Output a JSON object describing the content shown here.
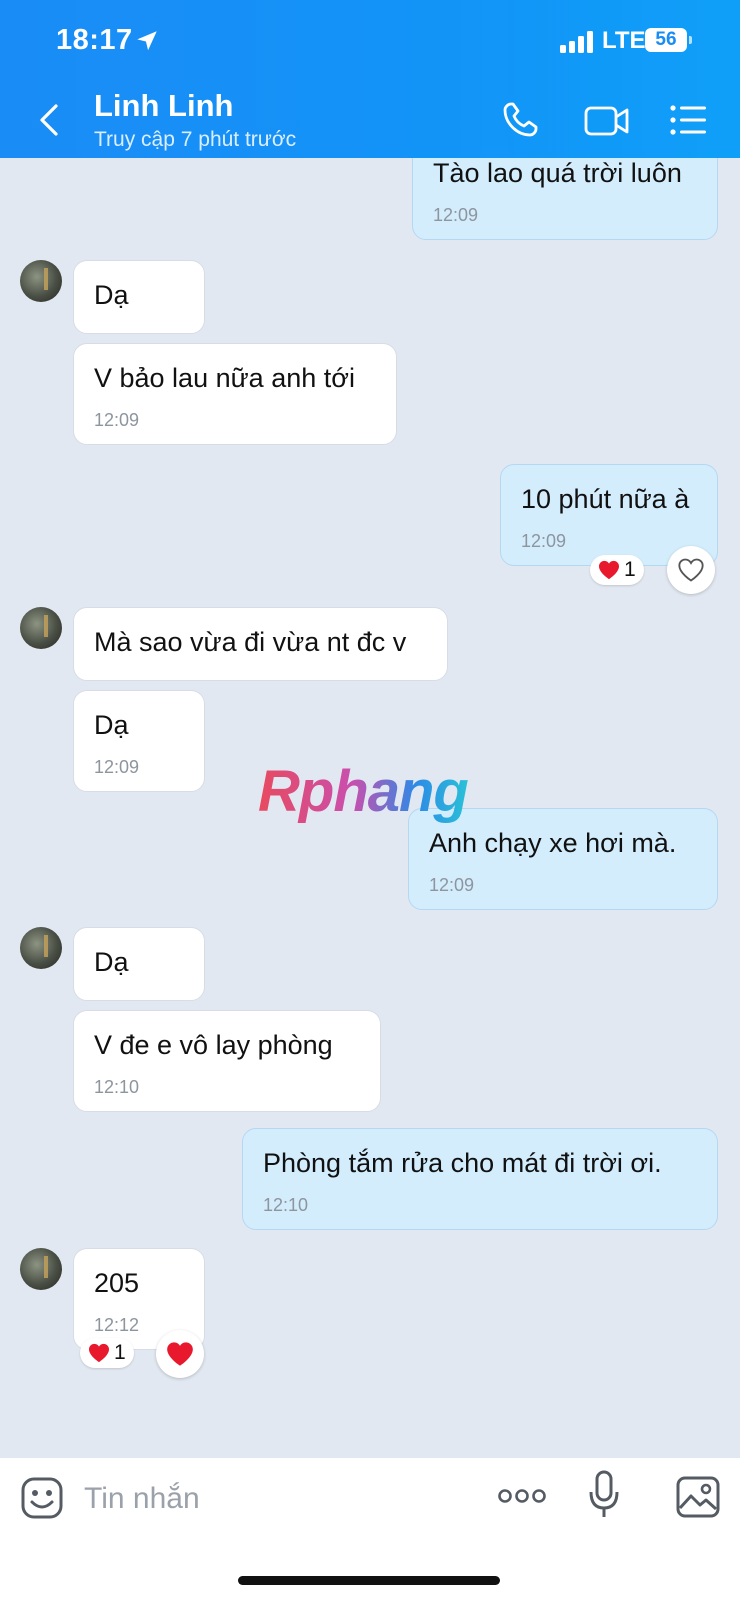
{
  "status_bar": {
    "time": "18:17",
    "network": "LTE",
    "battery": "56"
  },
  "header": {
    "contact_name": "Linh Linh",
    "contact_status": "Truy cập 7 phút trước"
  },
  "messages": [
    {
      "side": "out",
      "text": "Tào lao quá trời luôn",
      "time": "12:09"
    },
    {
      "side": "in",
      "text": "Dạ",
      "time": ""
    },
    {
      "side": "in",
      "text": "V bảo lau nữa anh tới",
      "time": "12:09"
    },
    {
      "side": "out",
      "text": "10 phút nữa à",
      "time": "12:09",
      "reaction": {
        "emoji": "heart",
        "count": "1"
      }
    },
    {
      "side": "in",
      "text": "Mà sao vừa đi vừa nt đc v",
      "time": ""
    },
    {
      "side": "in",
      "text": "Dạ",
      "time": "12:09"
    },
    {
      "side": "out",
      "text": "Anh chạy xe hơi mà.",
      "time": "12:09"
    },
    {
      "side": "in",
      "text": "Dạ",
      "time": ""
    },
    {
      "side": "in",
      "text": "V đe e vô lay phòng",
      "time": "12:10"
    },
    {
      "side": "out",
      "text": "Phòng tắm rửa cho mát đi trời ơi.",
      "time": "12:10"
    },
    {
      "side": "in",
      "text": "205",
      "time": "12:12",
      "reaction": {
        "emoji": "heart",
        "count": "1"
      }
    }
  ],
  "watermark": "Rphang",
  "input": {
    "placeholder": "Tin nhắn"
  },
  "colors": {
    "header": "#1a8cf6",
    "outgoing_bubble": "#d3edfd",
    "incoming_bubble": "#ffffff",
    "chat_background": "#e2e8f1",
    "heart": "#e8192c"
  },
  "icons": {
    "header": [
      "back-icon",
      "phone-icon",
      "video-call-icon",
      "menu-icon"
    ],
    "input": [
      "sticker-icon",
      "more-icon",
      "microphone-icon",
      "image-icon"
    ]
  }
}
